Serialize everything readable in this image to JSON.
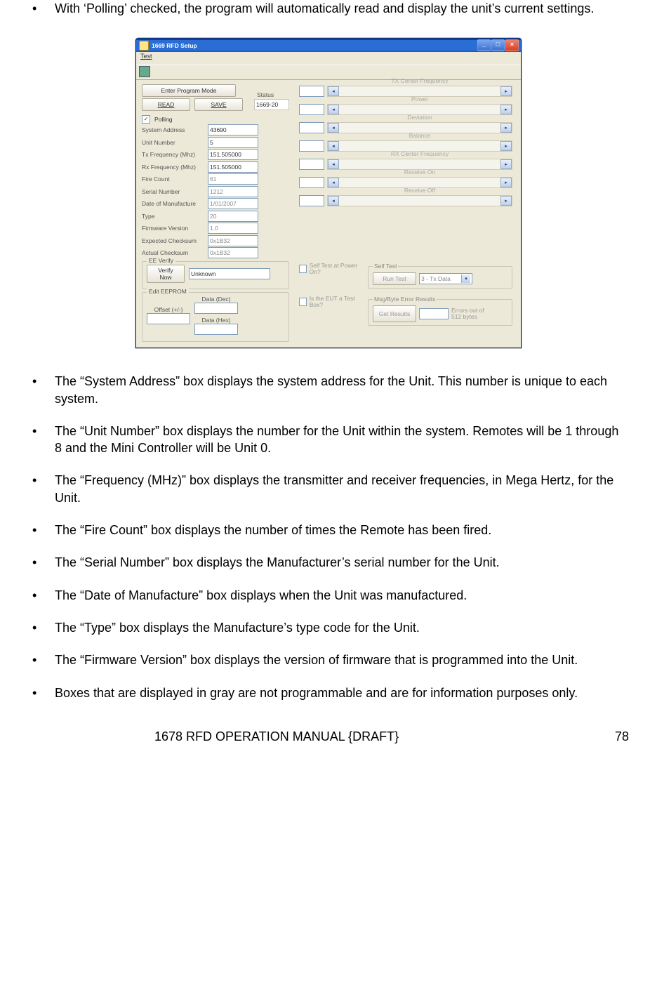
{
  "bullets_top": [
    "With ‘Polling’ checked, the program will automatically read and display the unit’s current settings."
  ],
  "bullets_bottom": [
    "The “System Address” box displays the system address for the Unit.  This number is unique to each system.",
    "The “Unit Number” box displays the number for the Unit within the system.  Remotes will be 1 through 8 and the Mini Controller will be Unit 0.",
    "The “Frequency (MHz)” box displays the transmitter and receiver frequencies, in Mega Hertz, for the Unit.",
    "The “Fire Count” box displays the number of times the Remote has been fired.",
    "The “Serial Number” box displays the Manufacturer’s serial number for the Unit.",
    "The “Date of Manufacture” box displays when the Unit was manufactured.",
    "The “Type” box displays the Manufacture’s type code for the Unit.",
    "The “Firmware Version” box displays the version of firmware that is programmed into the Unit.",
    "Boxes that are displayed in gray are not programmable and are for information purposes only."
  ],
  "footer": {
    "title": "1678 RFD OPERATION MANUAL {DRAFT}",
    "page": "78"
  },
  "app": {
    "title": "1669 RFD Setup",
    "menu": {
      "item0": "Test"
    },
    "buttons": {
      "enter_program_mode": "Enter Program Mode",
      "read": "READ",
      "save": "SAVE",
      "verify_now": "Verify Now",
      "run_test": "Run Test",
      "get_results": "Get Results"
    },
    "status": {
      "label": "Status",
      "value": "1669-20"
    },
    "polling": {
      "label": "Polling",
      "checked": "✓"
    },
    "fields": {
      "system_address": {
        "label": "System Address",
        "value": "43690",
        "gray": false
      },
      "unit_number": {
        "label": "Unit Number",
        "value": "5",
        "gray": false
      },
      "tx_freq": {
        "label": "Tx Frequency (Mhz)",
        "value": "151.505000",
        "gray": false
      },
      "rx_freq": {
        "label": "Rx Frequency (Mhz)",
        "value": "151.505000",
        "gray": false
      },
      "fire_count": {
        "label": "Fire Count",
        "value": "61",
        "gray": true
      },
      "serial_number": {
        "label": "Serial Number",
        "value": "1212",
        "gray": true
      },
      "date_manufacture": {
        "label": "Date of Manufacture",
        "value": "1/01/2007",
        "gray": true
      },
      "type": {
        "label": "Type",
        "value": "20",
        "gray": true
      },
      "firmware": {
        "label": "Firmware Version",
        "value": "1.0",
        "gray": true
      },
      "expected_cksum": {
        "label": "Expected Checksum",
        "value": "0x1B32",
        "gray": true
      },
      "actual_cksum": {
        "label": "Actual Checksum",
        "value": "0x1B32",
        "gray": true
      }
    },
    "ee_verify": {
      "title": "EE Verify",
      "value": "Unknown"
    },
    "edit_eeprom": {
      "title": "Edit EEPROM",
      "offset_label": "Offset (+/-)",
      "data_dec_label": "Data (Dec)",
      "data_hex_label": "Data (Hex)"
    },
    "sliders": {
      "s0": "TX Center Frequency",
      "s1": "Power",
      "s2": "Deviation",
      "s3": "Balance",
      "s4": "RX Center Frequency",
      "s5": "Receive On",
      "s6": "Receive Off"
    },
    "right_checks": {
      "c0": "Self Test at Power On?",
      "c1": "Is the EUT a Test Box?"
    },
    "self_test": {
      "title": "Self Test",
      "combo": "3 - Tx Data"
    },
    "msg_results": {
      "title": "Msg/Byte Error Results",
      "errors_label": "Errors out of 512 bytes"
    }
  }
}
